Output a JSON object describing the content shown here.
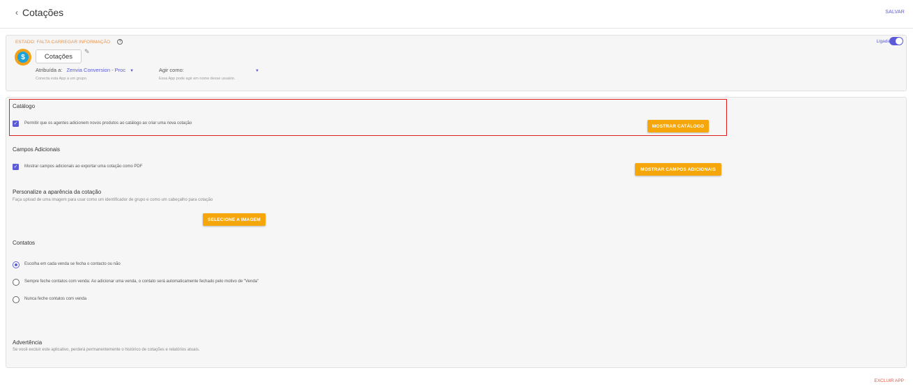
{
  "header": {
    "back_chevron": "‹",
    "title": "Cotações",
    "save_label": "SALVAR"
  },
  "status": {
    "estado": "ESTADO: FALTA CARREGAR INFORMAÇÃO",
    "help_icon": "?",
    "app_icon": "dollar-tag",
    "app_name": "Cotações",
    "assigned_label": "Atribuída a:",
    "assigned_value": "Zenvia Conversion - Proc",
    "assigned_hint": "Conecta esta App a um grupo.",
    "agent_label": "Agir como:",
    "agent_hint": "Essa App pode agir em nome desse usuário.",
    "toggle_label": "Ligada",
    "toggle_on": true
  },
  "catalog": {
    "title": "Catálogo",
    "checkbox_label": "Permitir que os agentes adicionem novos produtos ao catálogo ao criar uma nova cotação",
    "checked": true,
    "button": "MOSTRAR CATÁLOGO"
  },
  "additional": {
    "title": "Campos Adicionais",
    "checkbox_label": "Mostrar campos adicionais ao exportar uma cotação como PDF",
    "checked": true,
    "button": "MOSTRAR CAMPOS ADICIONAIS"
  },
  "appearance": {
    "title": "Personalize a aparência da cotação",
    "description": "Faça upload de uma imagem para usar como um identificador de grupo e como um cabeçalho para cotação",
    "button": "SELECIONE A IMAGEM"
  },
  "contacts": {
    "title": "Contatos",
    "options": [
      {
        "label": "Escolha em cada venda se fecha o contacto ou não",
        "selected": true
      },
      {
        "label": "Sempre feche contatos com venda: Ao adicionar uma venda, o contato será automaticamente fechado pelo motivo de \"Venda\"",
        "selected": false
      },
      {
        "label": "Nunca feche contatos com venda",
        "selected": false
      }
    ]
  },
  "warning": {
    "title": "Advertência",
    "description": "Se você excluir este aplicativo, perderá permanentemente o histórico de cotações e relatórios atuais."
  },
  "footer": {
    "delete_label": "EXCLUIR APP"
  },
  "colors": {
    "accent": "#5b5bd6",
    "button": "#f5a60b",
    "status_orange": "#e8914a",
    "danger": "#e05a4a",
    "highlight": "#e02020"
  }
}
